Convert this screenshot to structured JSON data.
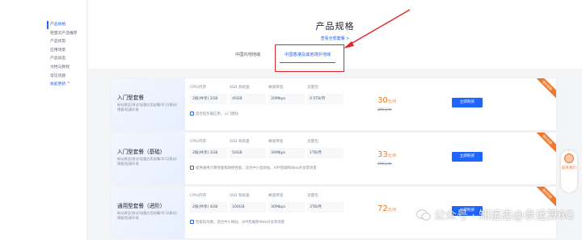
{
  "sidebar": {
    "items": [
      {
        "label": "产品规格",
        "active": true
      },
      {
        "label": "轻量云产品推荐",
        "active": false
      },
      {
        "label": "产品优势",
        "active": false
      },
      {
        "label": "应用场景",
        "active": false
      },
      {
        "label": "产品动态",
        "active": false
      },
      {
        "label": "文档与教程",
        "active": false
      },
      {
        "label": "常见问题",
        "active": false
      }
    ],
    "more_label": "收起更新 ^"
  },
  "header": {
    "title": "产品规格",
    "view_all": "查看全部套餐 >",
    "tabs": [
      {
        "label": "中国内地地域",
        "active": false
      },
      {
        "label": "中国香港及其他境外地域",
        "active": true
      }
    ]
  },
  "columns": [
    "CPU/内存",
    "SSD 系统盘",
    "峰值带宽",
    "流量包"
  ],
  "cards": [
    {
      "name": "入门型套餐",
      "desc": "新站建设/测试/轻量应用部署/学习/建站/博客/搭建环境",
      "specs": [
        "2核(共享) 2GB",
        "40GB",
        "20Mbps",
        "0.5TB/月"
      ],
      "note": "适合低负载应用、入门建站",
      "price": "30",
      "price_unit": "元/月",
      "orig_price": "288元/年",
      "buy_label": "立即购买",
      "ribbon": "限时特惠"
    },
    {
      "name": "入门型套餐（基础）",
      "desc": "新站建设/测试/轻量应用部署/学习/建站/博客/搭建环境",
      "specs": [
        "2核(共享) 2GB",
        "50GB",
        "30Mbps",
        "1TB/月"
      ],
      "note": "提供通用计算性能和网络性能，适合中小型网站、APP后端和Web开发等场景",
      "price": "33",
      "price_unit": "元/月",
      "orig_price": "396元/年",
      "buy_label": "立即购买",
      "ribbon": "限时特惠"
    },
    {
      "name": "通用型套餐（进阶）",
      "desc": "新站建设/测试/轻量应用部署/学习/建站/博客/搭建环境",
      "specs": [
        "2核(共享) 4GB",
        "100GB",
        "30Mbps",
        "3TB/月"
      ],
      "note": "性能较均衡，适合中小网站、APP后端和Web开发等场景",
      "price": "72",
      "price_unit": "元/月",
      "orig_price": "",
      "buy_label": "立即购买",
      "ribbon": "限时特惠"
    }
  ],
  "chat": {
    "label": "联系我们"
  },
  "watermark": "公众号 · 知运态@亲运算6G",
  "colors": {
    "accent": "#1f66ff",
    "price": "#f27b2a",
    "highlight": "#e02a2a"
  }
}
